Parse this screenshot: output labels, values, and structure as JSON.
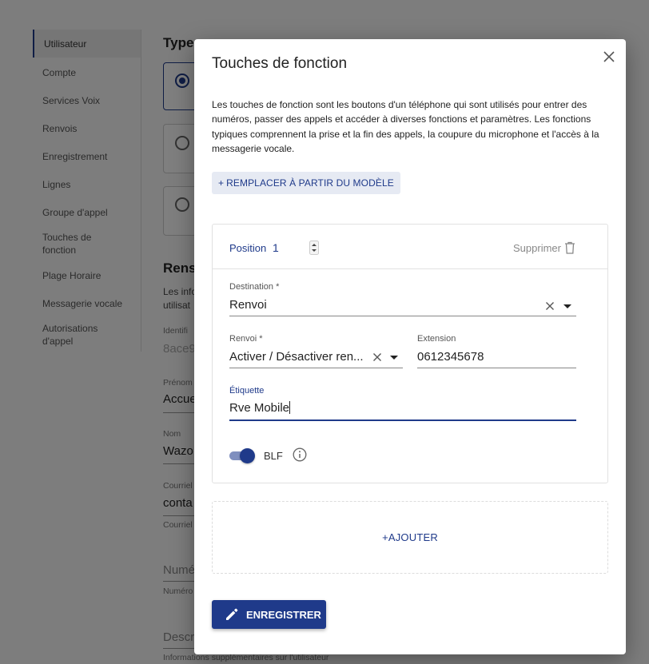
{
  "sidebar": {
    "items": [
      {
        "label": "Utilisateur"
      },
      {
        "label": "Compte"
      },
      {
        "label": "Services Voix"
      },
      {
        "label": "Renvois"
      },
      {
        "label": "Enregistrement"
      },
      {
        "label": "Lignes"
      },
      {
        "label": "Groupe d'appel"
      },
      {
        "label": "Touches de fonction"
      },
      {
        "label": "Plage Horaire"
      },
      {
        "label": "Messagerie vocale"
      },
      {
        "label": "Autorisations d'appel"
      }
    ]
  },
  "background": {
    "heading_type": "Type",
    "heading_renseignements": "Rens",
    "info_text": "Les info",
    "info_text_2": "utilisat",
    "identifier_label": "Identifi",
    "identifier_value": "8ace9",
    "firstname_label": "Prénom",
    "firstname_value": "Accue",
    "lastname_label": "Nom",
    "lastname_value": "Wazo",
    "email_label": "Courriel",
    "email_value": "conta",
    "email_helper": "Courriel",
    "number_placeholder": "Numé",
    "number_helper": "Numéro",
    "description_placeholder": "Descr",
    "description_helper": "Informations supplémentaires sur l'utilisateur"
  },
  "dialog": {
    "title": "Touches de fonction",
    "description": "Les touches de fonction sont les boutons d'un téléphone qui sont utilisés pour entrer des numéros, passer des appels et accéder à diverses fonctions et paramètres. Les fonctions typiques comprennent la prise et la fin des appels, la coupure du microphone et l'accès à la messagerie vocale.",
    "template_button": "REMPLACER À PARTIR DU MODÈLE",
    "function_key": {
      "position_label": "Position",
      "position_value": "1",
      "delete_label": "Supprimer",
      "destination_label": "Destination *",
      "destination_value": "Renvoi",
      "forward_label": "Renvoi *",
      "forward_value": "Activer / Désactiver ren...",
      "extension_label": "Extension",
      "extension_value": "0612345678",
      "tag_label": "Étiquette",
      "tag_value": "Rve Mobile",
      "blf_label": "BLF",
      "blf_enabled": true
    },
    "add_button": "AJOUTER",
    "save_button": "ENREGISTRER"
  },
  "colors": {
    "primary": "#1f3a8a",
    "template_button_bg": "#e6eaf3",
    "overlay": "rgba(0,0,0,0.5)"
  }
}
